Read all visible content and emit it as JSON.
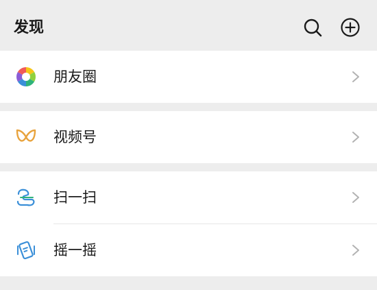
{
  "header": {
    "title": "发现",
    "search_icon": "search-icon",
    "add_icon": "plus-circle-icon"
  },
  "menu": {
    "moments": {
      "label": "朋友圈",
      "icon": "moments-aperture-icon"
    },
    "channels": {
      "label": "视频号",
      "icon": "channels-butterfly-icon"
    },
    "scan": {
      "label": "扫一扫",
      "icon": "scan-icon"
    },
    "shake": {
      "label": "摇一摇",
      "icon": "shake-phone-icon"
    }
  },
  "colors": {
    "background": "#ededed",
    "cell": "#ffffff",
    "text": "#1a1a1a",
    "chevron": "#b2b2b2",
    "channels_accent": "#e8a33d",
    "scan_accent": "#3a8fd8"
  }
}
